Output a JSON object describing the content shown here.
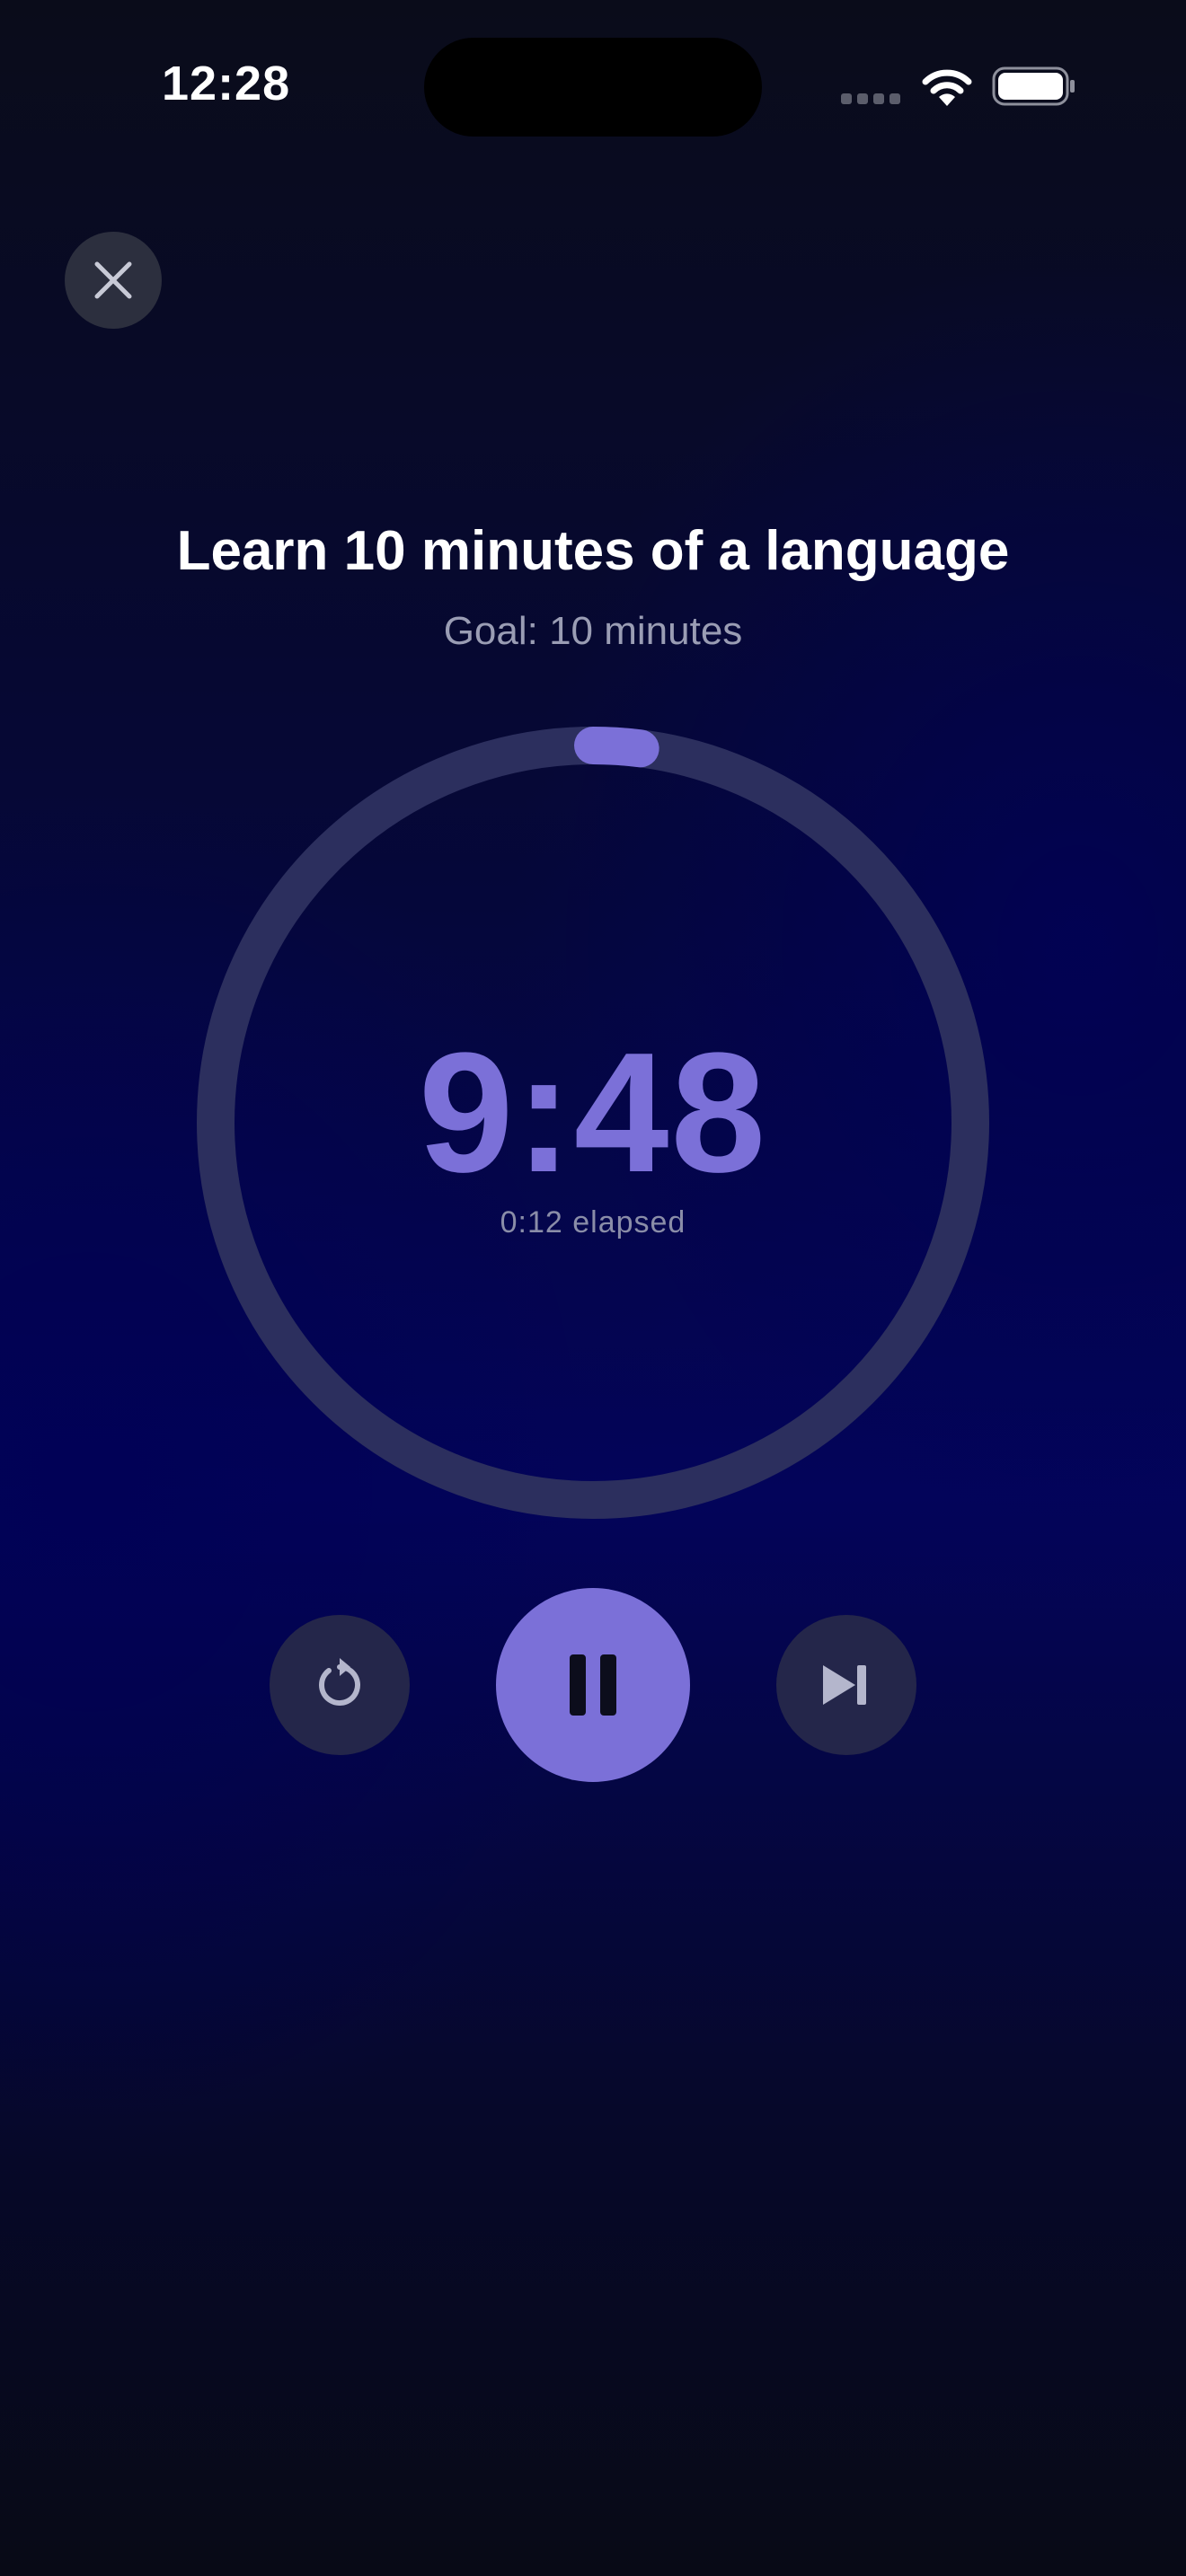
{
  "status_bar": {
    "time": "12:28"
  },
  "session": {
    "title": "Learn 10 minutes of a language",
    "goal_text": "Goal: 10 minutes",
    "time_remaining": "9:48",
    "elapsed_text": "0:12 elapsed",
    "progress_fraction": 0.02
  },
  "controls": {
    "close": "close-icon",
    "restart": "restart-icon",
    "pause": "pause-icon",
    "skip": "skip-forward-icon"
  },
  "colors": {
    "accent": "#7b70d8",
    "ring_track": "#2c2f5e",
    "secondary_button": "#24264a"
  }
}
